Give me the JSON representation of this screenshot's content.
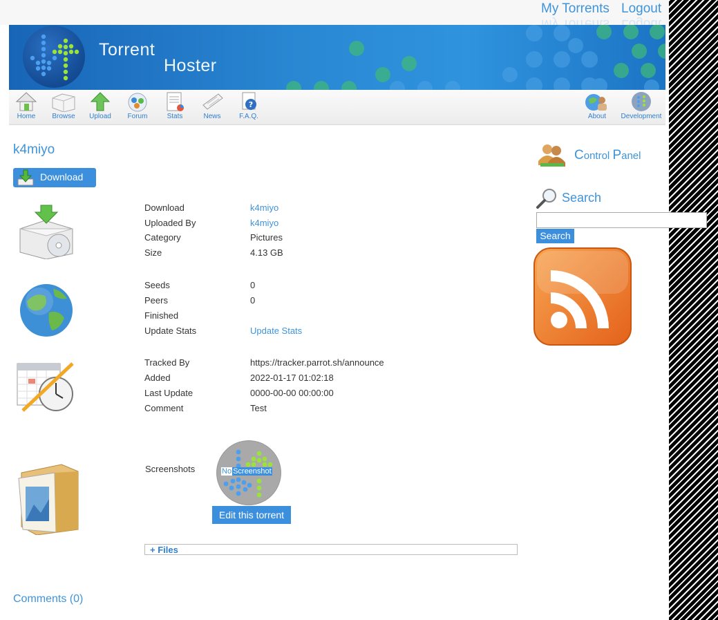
{
  "header": {
    "my_torrents": "My Torrents",
    "logout": "Logout"
  },
  "banner": {
    "brand_line1": "Torrent",
    "brand_line2": "Hoster"
  },
  "nav": {
    "left": [
      {
        "label": "Home",
        "icon": "home-icon"
      },
      {
        "label": "Browse",
        "icon": "browse-icon"
      },
      {
        "label": "Upload",
        "icon": "upload-icon"
      },
      {
        "label": "Forum",
        "icon": "forum-icon"
      },
      {
        "label": "Stats",
        "icon": "stats-icon"
      },
      {
        "label": "News",
        "icon": "news-icon"
      },
      {
        "label": "F.A.Q.",
        "icon": "faq-icon"
      }
    ],
    "right": [
      {
        "label": "About",
        "icon": "about-icon"
      },
      {
        "label": "Development",
        "icon": "development-icon"
      }
    ]
  },
  "torrent": {
    "title": "k4miyo",
    "download_button": "Download",
    "download_label": "Download",
    "download_value": "k4miyo",
    "uploaded_by_label": "Uploaded By",
    "uploaded_by_value": "k4miyo",
    "category_label": "Category",
    "category_value": "Pictures",
    "size_label": "Size",
    "size_value": "4.13 GB",
    "seeds_label": "Seeds",
    "seeds_value": "0",
    "peers_label": "Peers",
    "peers_value": "0",
    "finished_label": "Finished",
    "finished_value": "",
    "update_stats_label": "Update Stats",
    "update_stats_link": "Update Stats",
    "tracked_by_label": "Tracked By",
    "tracked_by_value": "https://tracker.parrot.sh/announce",
    "added_label": "Added",
    "added_value": "2022-01-17 01:02:18",
    "last_update_label": "Last Update",
    "last_update_value": "0000-00-00 00:00:00",
    "comment_label": "Comment",
    "comment_value": "Test",
    "screenshots_label": "Screenshots",
    "no_screenshot_no": "No",
    "no_screenshot_rest": "Screenshot",
    "edit_button": "Edit this torrent",
    "files_toggle": "+ Files",
    "comments_link": "Comments (0)"
  },
  "sidebar": {
    "control_panel_c": "C",
    "control_panel_ontrol": "ontrol ",
    "control_panel_p": "P",
    "control_panel_anel": "anel",
    "search_title": "Search",
    "search_placeholder": "",
    "search_button": "Search"
  },
  "colors": {
    "accent": "#3f93d9",
    "button": "#3b8fdd",
    "rss": "#f07d1e",
    "banner": "#2a88d3"
  }
}
